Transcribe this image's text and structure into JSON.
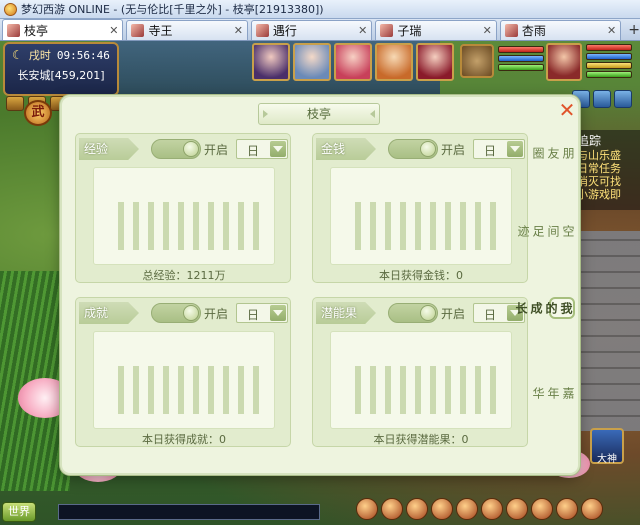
{
  "window": {
    "title": "梦幻西游 ONLINE - (无与伦比[千里之外] - 枝亭[21913380])"
  },
  "tabs": [
    {
      "label": "枝亭",
      "active": true
    },
    {
      "label": "寺王",
      "active": false
    },
    {
      "label": "遇行",
      "active": false
    },
    {
      "label": "子瑞",
      "active": false
    },
    {
      "label": "杏雨",
      "active": false
    }
  ],
  "hud": {
    "clock_label": "戌时",
    "time": "09:56:46",
    "location": "长安城[459,201]",
    "badge": "武",
    "world_button": "世界",
    "daxia_button": "大神"
  },
  "quest_panel": {
    "title": "追踪",
    "lines": [
      "与山乐盛",
      "日常任务",
      "消灭可找",
      "小游戏即"
    ]
  },
  "modal": {
    "title": "枝亭",
    "close_symbol": "✕",
    "panels": {
      "exp": {
        "label": "经验",
        "toggle": "开启",
        "select": "日",
        "footer": "总经验：1211万"
      },
      "money": {
        "label": "金钱",
        "toggle": "开启",
        "select": "日",
        "footer": "本日获得金钱：0"
      },
      "achievement": {
        "label": "成就",
        "toggle": "开启",
        "select": "日",
        "footer": "本日获得成就：0"
      },
      "potential": {
        "label": "潜能果",
        "toggle": "开启",
        "select": "日",
        "footer": "本日获得潜能果：0"
      }
    },
    "side_nav": [
      {
        "label": "朋友圈",
        "active": false
      },
      {
        "label": "空间足迹",
        "active": false
      },
      {
        "label": "我的成长",
        "active": true
      },
      {
        "label": "嘉年华",
        "active": false
      }
    ]
  },
  "colors": {
    "modal_bg": "#eef4df",
    "panel_bg": "#e2ecce",
    "accent_close": "#e0532a",
    "text_muted": "#5a6a40"
  }
}
